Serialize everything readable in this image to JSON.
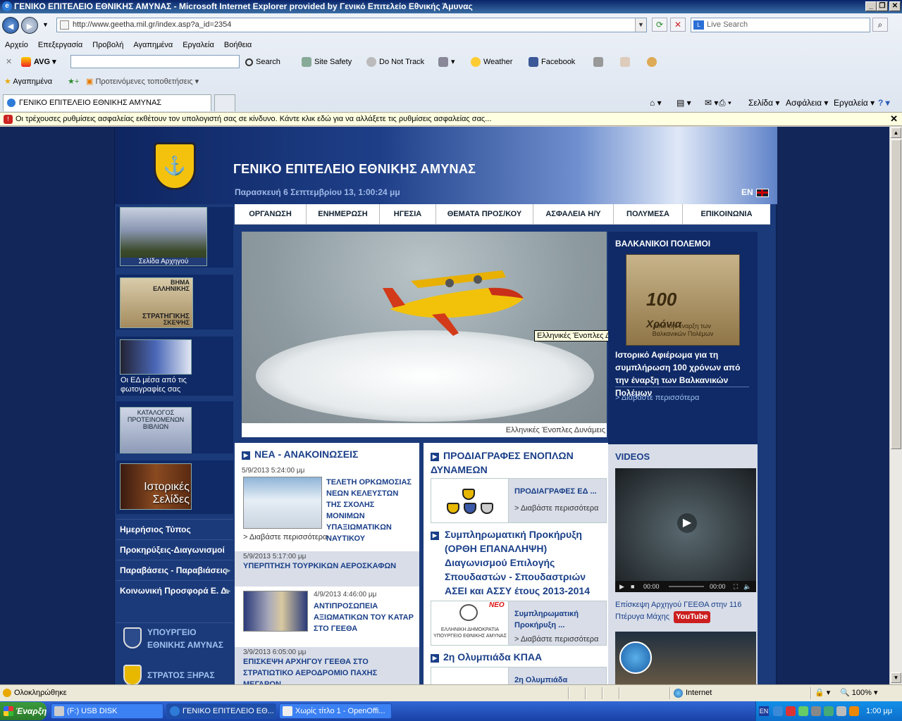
{
  "window": {
    "title": "ΓΕΝΙΚΟ ΕΠΙΤΕΛΕΙΟ ΕΘΝΙΚΗΣ ΑΜΥΝΑΣ - Microsoft Internet Explorer provided by Γενικό Επιτελείο Εθνικής Άμυνας"
  },
  "browser": {
    "url": "http://www.geetha.mil.gr/index.asp?a_id=2354",
    "search_placeholder": "Live Search",
    "menu": [
      "Αρχείο",
      "Επεξεργασία",
      "Προβολή",
      "Αγαπημένα",
      "Εργαλεία",
      "Βοήθεια"
    ],
    "avg": {
      "brand": "AVG",
      "search": "Search",
      "site_safety": "Site Safety",
      "do_not_track": "Do Not Track",
      "weather": "Weather",
      "facebook": "Facebook"
    },
    "favorites": {
      "label": "Αγαπημένα",
      "suggested": "Προτεινόμενες τοποθετήσεις"
    },
    "tab_title": "ΓΕΝΙΚΟ ΕΠΙΤΕΛΕΙΟ ΕΘΝΙΚΗΣ ΑΜΥΝΑΣ",
    "commands": {
      "page": "Σελίδα",
      "safety": "Ασφάλεια",
      "tools": "Εργαλεία"
    },
    "infobar": "Οι τρέχουσες ρυθμίσεις ασφαλείας εκθέτουν τον υπολογιστή σας σε κίνδυνο. Κάντε κλικ εδώ για να αλλάξετε τις ρυθμίσεις ασφαλείας σας...",
    "status": {
      "text": "Ολοκληρώθηκε",
      "zone": "Internet",
      "zoom": "100%"
    }
  },
  "site": {
    "title": "ΓΕΝΙΚΟ ΕΠΙΤΕΛΕΙΟ ΕΘΝΙΚΗΣ ΑΜΥΝΑΣ",
    "date": "Παρασκευή 6 Σεπτεμβρίου 13,  1:00:24 μμ",
    "lang": "EN",
    "nav": [
      "ΟΡΓΑΝΩΣΗ",
      "ΕΝΗΜΕΡΩΣΗ",
      "ΗΓΕΣΙΑ",
      "ΘΕΜΑΤΑ ΠΡΟΣ/ΚΟΥ",
      "ΑΣΦΑΛΕΙΑ Η/Υ",
      "ΠΟΛΥΜΕΣΑ",
      "ΕΠΙΚΟΙΝΩΝΙΑ"
    ],
    "left": {
      "chief_caption": "Σελίδα Αρχηγού",
      "vima_1": "ΒΗΜΑ",
      "vima_2": "ΕΛΛΗΝΙΚΗΣ",
      "vima_3": "ΣΤΡΑΤΗΓΙΚΗΣ",
      "vima_4": "ΣΚΕΨΗΣ",
      "photos": "Οι ΕΔ μέσα από τις φωτογραφίες σας",
      "books": "ΚΑΤΑΛΟΓΟΣ ΠΡΟΤΕΙΝΟΜΕΝΩΝ ΒΙΒΛΙΩΝ",
      "historical": "Ιστορικές Σελίδες",
      "menu": [
        "Ημερήσιος Τύπος",
        "Προκηρύξεις-Διαγωνισμοί",
        "Παραβάσεις - Παραβιάσεις",
        "Κοινωνική Προσφορά Ε. Δ."
      ],
      "ext1": "ΥΠΟΥΡΓΕΙΟ ΕΘΝΙΚΗΣ ΑΜΥΝΑΣ",
      "ext2": "ΣΤΡΑΤΟΣ ΞΗΡΑΣ"
    },
    "hero": {
      "caption": "Ελληνικές Ένοπλες Δυνάμεις",
      "tooltip": "Ελληνικές Ένοπλες Δυνάμεις"
    },
    "balkan": {
      "heading": "ΒΑΛΚΑΝΙΚΟΙ ΠΟΛΕΜΟΙ",
      "img_num": "100",
      "img_word": "Χρόνια",
      "img_text": "από την έναρξη των Βαλκανικών Πολέμων",
      "text": "Ιστορικό Αφιέρωμα για τη συμπλήρωση 100 χρόνων από την έναρξη των Βαλκανικών Πολέμων",
      "more": "> Διαβάστε περισσότερα"
    },
    "news": {
      "heading": "ΝΕΑ - ΑΝΑΚΟΙΝΩΣΕΙΣ",
      "items": [
        {
          "date": "5/9/2013 5:24:00 μμ",
          "title": "ΤΕΛΕΤΗ ΟΡΚΩΜΟΣΙΑΣ ΝΕΩΝ ΚΕΛΕΥΣΤΩΝ ΤΗΣ ΣΧΟΛΗΣ ΜΟΝΙΜΩΝ ΥΠΑΞΙΩΜΑΤΙΚΩΝ ΝΑΥΤΙΚΟΥ",
          "more": "> Διαβάστε περισσότερα"
        },
        {
          "date": "5/9/2013 5:17:00 μμ",
          "title": "ΥΠΕΡΠΤΗΣΗ ΤΟΥΡΚΙΚΩΝ ΑΕΡΟΣΚΑΦΩΝ"
        },
        {
          "date": "4/9/2013 4:46:00 μμ",
          "title": "ΑΝΤΙΠΡΟΣΩΠΕΙΑ ΑΞΙΩΜΑΤΙΚΩΝ ΤΟΥ ΚΑΤΑΡ ΣΤΟ ΓΕΕΘΑ"
        },
        {
          "date": "3/9/2013 6:05:00 μμ",
          "title": "ΕΠΙΣΚΕΨΗ ΑΡΧΗΓΟΥ ΓΕΕΘΑ ΣΤΟ ΣΤΡΑΤΙΩΤΙΚΟ ΑΕΡΟΔΡΟΜΙΟ ΠΑΧΗΣ ΜΕΓΑΡΩΝ"
        }
      ]
    },
    "specs": {
      "heading": "ΠΡΟΔΙΑΓΡΑΦΕΣ ΕΝΟΠΛΩΝ ΔΥΝΑΜΕΩΝ",
      "box1_title": "ΠΡΟΔΙΑΓΡΑΦΕΣ ΕΔ ...",
      "more": "> Διαβάστε περισσότερα",
      "notice_title": "Συμπληρωματική Προκήρυξη (ΟΡΘΗ ΕΠΑΝΑΛΗΨΗ) Διαγωνισμού Επιλογής Σπουδαστών - Σπουδαστριών ΑΣΕΙ και ΑΣΣΥ έτους 2013-2014",
      "notice_box_title": "Συμπληρωματική Προκήρυξη ...",
      "notice_badge": "ΝΕΟ",
      "notice_img_1": "ΕΛΛΗΝΙΚΗ ΔΗΜΟΚΡΑΤΙΑ",
      "notice_img_2": "ΥΠΟΥΡΓΕΙΟ ΕΘΝΙΚΗΣ ΑΜΥΝΑΣ",
      "olympiad": "2η Ολυμπιάδα ΚΠΑΑ",
      "olympiad_box": "2η Ολυμπιάδα"
    },
    "videos": {
      "heading": "VIDEOS",
      "time_elapsed": "00:00",
      "time_total": "00:00",
      "caption": "Επίσκεψη Αρχηγού ΓΕΕΘΑ στην 116 Πτέρυγα Μάχης",
      "youtube": "YouTube"
    }
  },
  "taskbar": {
    "start": "Έναρξη",
    "tasks": [
      "(F:) USB DISK",
      "ΓΕΝΙΚΟ ΕΠΙΤΕΛΕΙΟ ΕΘ...",
      "Χωρίς τίτλο 1 - OpenOffi..."
    ],
    "lang": "EN",
    "clock": "1:00 μμ"
  },
  "colors": {
    "site_blue": "#1b3a7a",
    "link_blue": "#1a3f88",
    "infobar": "#ffffe1"
  }
}
